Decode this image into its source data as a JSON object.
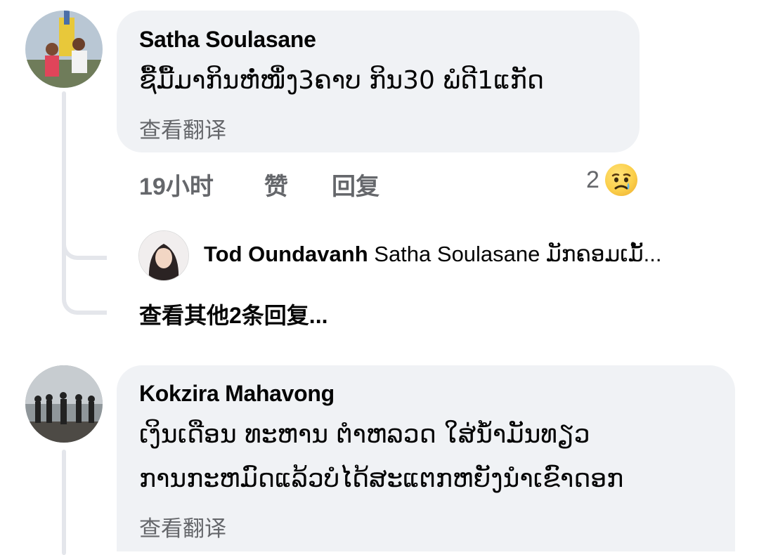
{
  "comments": [
    {
      "author": "Satha Soulasane",
      "text_lines": [
        "ຊື້ມື້ມາກິນຫໍ່ໜຶ່ງ3ຄາບ ກິນ30 ພໍດີ1ແກັດ"
      ],
      "translate_label": "查看翻译",
      "time": "19小时",
      "like_label": "赞",
      "reply_label": "回复",
      "reaction_count": "2",
      "reaction_icon": "sad-face-icon",
      "replies": [
        {
          "author": "Tod Oundavanh",
          "text": "Satha Soulasane ມັກຄອມເມັ້..."
        }
      ],
      "more_replies_label": "查看其他2条回复..."
    },
    {
      "author": "Kokzira Mahavong",
      "text_lines": [
        "ເງິນເດືອນ ທະຫານ ຕຳຫລວດ ໃສ່ນ້ຳມັນທຽວ",
        "ການກະຫມົດແລ້ວບໍໄດ້ສະແຕກຫຍັງນຳເຂົາດອກ"
      ],
      "translate_label": "查看翻译"
    }
  ]
}
